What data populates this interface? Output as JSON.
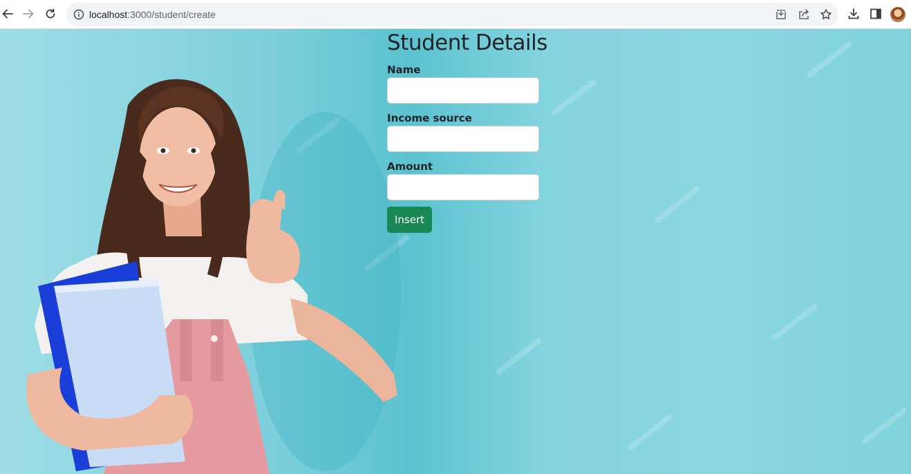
{
  "browser": {
    "url_host": "localhost",
    "url_rest": ":3000/student/create",
    "icons": [
      "back-icon",
      "forward-icon",
      "reload-icon",
      "site-info-icon",
      "install-app-icon",
      "share-icon",
      "bookmark-star-icon",
      "downloads-icon",
      "side-panel-icon",
      "profile-avatar"
    ]
  },
  "page": {
    "title": "Student Details",
    "fields": [
      {
        "label": "Name",
        "value": "",
        "placeholder": ""
      },
      {
        "label": "Income source",
        "value": "",
        "placeholder": ""
      },
      {
        "label": "Amount",
        "value": "",
        "placeholder": ""
      }
    ],
    "submit_label": "Insert"
  },
  "colors": {
    "button": "#198754",
    "background": "#7fd2dc",
    "text": "#212529"
  }
}
